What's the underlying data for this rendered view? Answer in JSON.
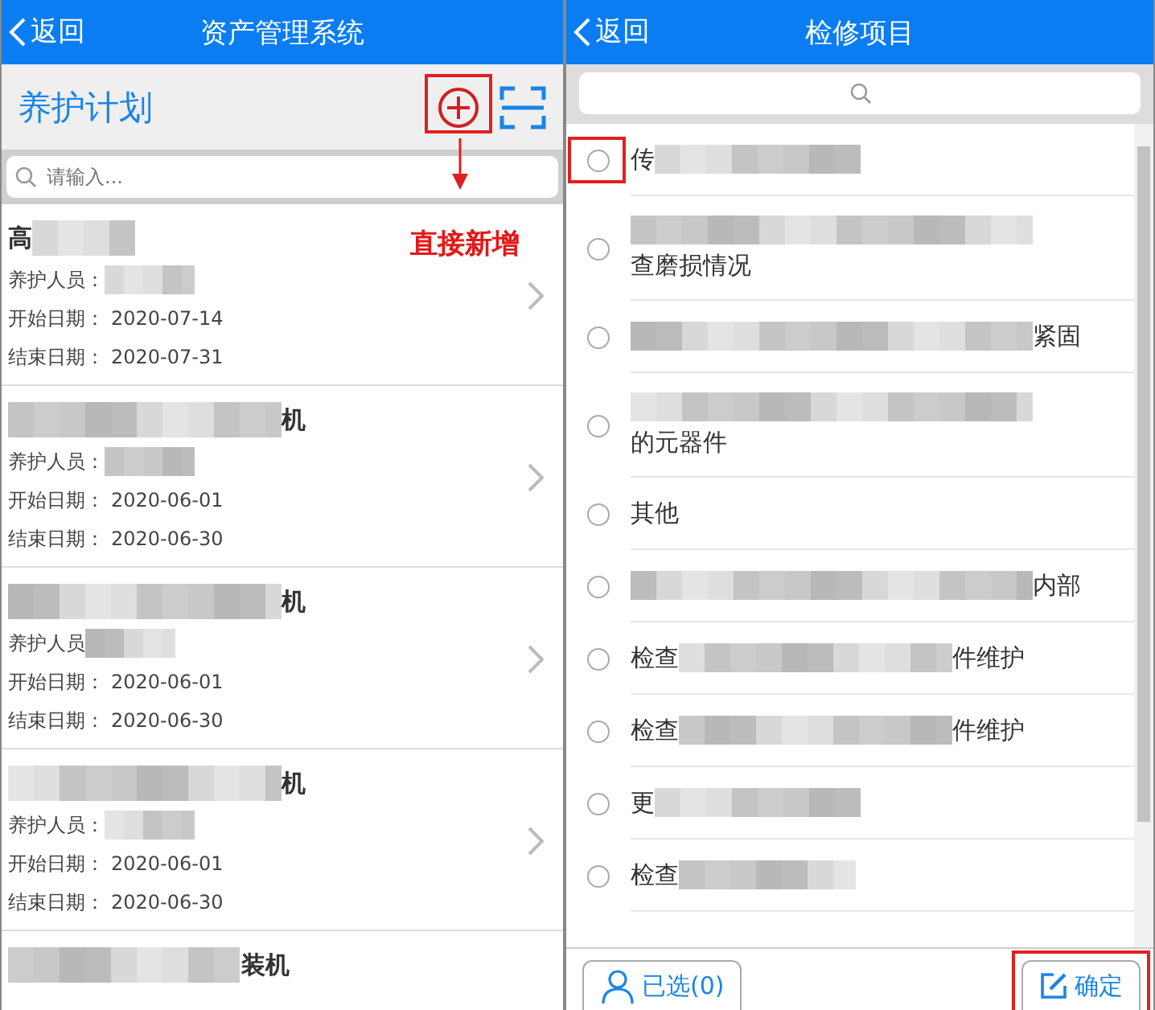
{
  "left_screen": {
    "header": {
      "back": "返回",
      "title": "资产管理系统"
    },
    "page_title": "养护计划",
    "annotation": "直接新增",
    "search": {
      "placeholder": "请输入..."
    },
    "records": [
      {
        "name_before": "高",
        "blurred": true,
        "fields": [
          {
            "label": "养护人员：",
            "blurred": true
          },
          {
            "label": "开始日期：",
            "value": "2020-07-14"
          },
          {
            "label": "结束日期：",
            "value": "2020-07-31"
          }
        ]
      },
      {
        "blurred": true,
        "name_after": "机",
        "fields": [
          {
            "label": "养护人员：",
            "blurred": true
          },
          {
            "label": "开始日期：",
            "value": "2020-06-01"
          },
          {
            "label": "结束日期：",
            "value": "2020-06-30"
          }
        ]
      },
      {
        "blurred": true,
        "name_after": "机",
        "fields": [
          {
            "label": "养护人员",
            "blurred": true
          },
          {
            "label": "开始日期：",
            "value": "2020-06-01"
          },
          {
            "label": "结束日期：",
            "value": "2020-06-30"
          }
        ]
      },
      {
        "blurred": true,
        "name_after": "机",
        "fields": [
          {
            "label": "养护人员：",
            "blurred": true
          },
          {
            "label": "开始日期：",
            "value": "2020-06-01"
          },
          {
            "label": "结束日期：",
            "value": "2020-06-30"
          }
        ]
      },
      {
        "blurred": true,
        "name_after": "装机"
      }
    ]
  },
  "right_screen": {
    "header": {
      "back": "返回",
      "title": "检修项目"
    },
    "items": [
      {
        "before": "传",
        "blurred": true,
        "selected": false,
        "highlighted": true
      },
      {
        "blurred": true,
        "second_line": "查磨损情况",
        "selected": false,
        "highlighted": false
      },
      {
        "blurred": true,
        "after": "紧固",
        "selected": false,
        "highlighted": false
      },
      {
        "blurred": true,
        "second_line": "的元器件",
        "selected": false,
        "highlighted": false
      },
      {
        "before": "其他",
        "blurred": false,
        "selected": false,
        "highlighted": false
      },
      {
        "blurred": true,
        "after": "内部",
        "selected": false,
        "highlighted": false
      },
      {
        "before": "检查",
        "blurred": true,
        "after": "件维护",
        "selected": false,
        "highlighted": false
      },
      {
        "before": "检查",
        "blurred": true,
        "after": "件维护",
        "selected": false,
        "highlighted": false
      },
      {
        "before": "更",
        "blurred": true,
        "selected": false,
        "highlighted": false
      },
      {
        "before": "检查",
        "blurred": true,
        "selected": false,
        "highlighted": false
      }
    ],
    "selected_button": "已选(0)",
    "confirm_button": "确定"
  }
}
